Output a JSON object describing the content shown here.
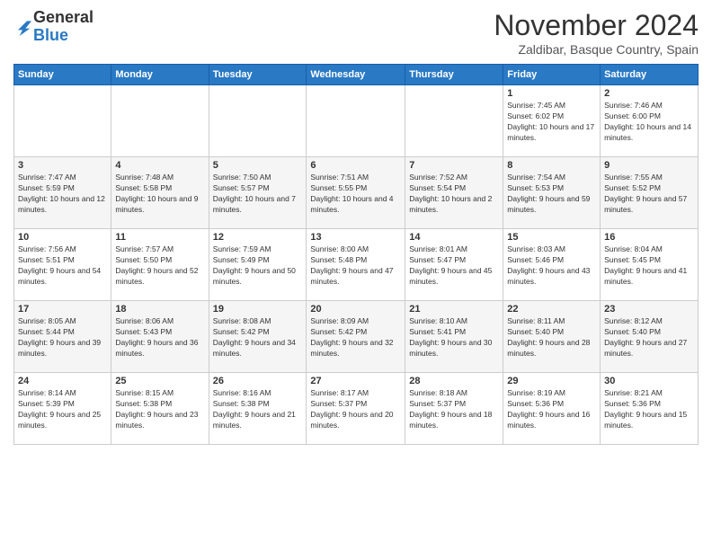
{
  "logo": {
    "line1": "General",
    "line2": "Blue"
  },
  "title": "November 2024",
  "location": "Zaldibar, Basque Country, Spain",
  "weekdays": [
    "Sunday",
    "Monday",
    "Tuesday",
    "Wednesday",
    "Thursday",
    "Friday",
    "Saturday"
  ],
  "weeks": [
    [
      {
        "day": "",
        "info": ""
      },
      {
        "day": "",
        "info": ""
      },
      {
        "day": "",
        "info": ""
      },
      {
        "day": "",
        "info": ""
      },
      {
        "day": "",
        "info": ""
      },
      {
        "day": "1",
        "info": "Sunrise: 7:45 AM\nSunset: 6:02 PM\nDaylight: 10 hours and 17 minutes."
      },
      {
        "day": "2",
        "info": "Sunrise: 7:46 AM\nSunset: 6:00 PM\nDaylight: 10 hours and 14 minutes."
      }
    ],
    [
      {
        "day": "3",
        "info": "Sunrise: 7:47 AM\nSunset: 5:59 PM\nDaylight: 10 hours and 12 minutes."
      },
      {
        "day": "4",
        "info": "Sunrise: 7:48 AM\nSunset: 5:58 PM\nDaylight: 10 hours and 9 minutes."
      },
      {
        "day": "5",
        "info": "Sunrise: 7:50 AM\nSunset: 5:57 PM\nDaylight: 10 hours and 7 minutes."
      },
      {
        "day": "6",
        "info": "Sunrise: 7:51 AM\nSunset: 5:55 PM\nDaylight: 10 hours and 4 minutes."
      },
      {
        "day": "7",
        "info": "Sunrise: 7:52 AM\nSunset: 5:54 PM\nDaylight: 10 hours and 2 minutes."
      },
      {
        "day": "8",
        "info": "Sunrise: 7:54 AM\nSunset: 5:53 PM\nDaylight: 9 hours and 59 minutes."
      },
      {
        "day": "9",
        "info": "Sunrise: 7:55 AM\nSunset: 5:52 PM\nDaylight: 9 hours and 57 minutes."
      }
    ],
    [
      {
        "day": "10",
        "info": "Sunrise: 7:56 AM\nSunset: 5:51 PM\nDaylight: 9 hours and 54 minutes."
      },
      {
        "day": "11",
        "info": "Sunrise: 7:57 AM\nSunset: 5:50 PM\nDaylight: 9 hours and 52 minutes."
      },
      {
        "day": "12",
        "info": "Sunrise: 7:59 AM\nSunset: 5:49 PM\nDaylight: 9 hours and 50 minutes."
      },
      {
        "day": "13",
        "info": "Sunrise: 8:00 AM\nSunset: 5:48 PM\nDaylight: 9 hours and 47 minutes."
      },
      {
        "day": "14",
        "info": "Sunrise: 8:01 AM\nSunset: 5:47 PM\nDaylight: 9 hours and 45 minutes."
      },
      {
        "day": "15",
        "info": "Sunrise: 8:03 AM\nSunset: 5:46 PM\nDaylight: 9 hours and 43 minutes."
      },
      {
        "day": "16",
        "info": "Sunrise: 8:04 AM\nSunset: 5:45 PM\nDaylight: 9 hours and 41 minutes."
      }
    ],
    [
      {
        "day": "17",
        "info": "Sunrise: 8:05 AM\nSunset: 5:44 PM\nDaylight: 9 hours and 39 minutes."
      },
      {
        "day": "18",
        "info": "Sunrise: 8:06 AM\nSunset: 5:43 PM\nDaylight: 9 hours and 36 minutes."
      },
      {
        "day": "19",
        "info": "Sunrise: 8:08 AM\nSunset: 5:42 PM\nDaylight: 9 hours and 34 minutes."
      },
      {
        "day": "20",
        "info": "Sunrise: 8:09 AM\nSunset: 5:42 PM\nDaylight: 9 hours and 32 minutes."
      },
      {
        "day": "21",
        "info": "Sunrise: 8:10 AM\nSunset: 5:41 PM\nDaylight: 9 hours and 30 minutes."
      },
      {
        "day": "22",
        "info": "Sunrise: 8:11 AM\nSunset: 5:40 PM\nDaylight: 9 hours and 28 minutes."
      },
      {
        "day": "23",
        "info": "Sunrise: 8:12 AM\nSunset: 5:40 PM\nDaylight: 9 hours and 27 minutes."
      }
    ],
    [
      {
        "day": "24",
        "info": "Sunrise: 8:14 AM\nSunset: 5:39 PM\nDaylight: 9 hours and 25 minutes."
      },
      {
        "day": "25",
        "info": "Sunrise: 8:15 AM\nSunset: 5:38 PM\nDaylight: 9 hours and 23 minutes."
      },
      {
        "day": "26",
        "info": "Sunrise: 8:16 AM\nSunset: 5:38 PM\nDaylight: 9 hours and 21 minutes."
      },
      {
        "day": "27",
        "info": "Sunrise: 8:17 AM\nSunset: 5:37 PM\nDaylight: 9 hours and 20 minutes."
      },
      {
        "day": "28",
        "info": "Sunrise: 8:18 AM\nSunset: 5:37 PM\nDaylight: 9 hours and 18 minutes."
      },
      {
        "day": "29",
        "info": "Sunrise: 8:19 AM\nSunset: 5:36 PM\nDaylight: 9 hours and 16 minutes."
      },
      {
        "day": "30",
        "info": "Sunrise: 8:21 AM\nSunset: 5:36 PM\nDaylight: 9 hours and 15 minutes."
      }
    ]
  ]
}
